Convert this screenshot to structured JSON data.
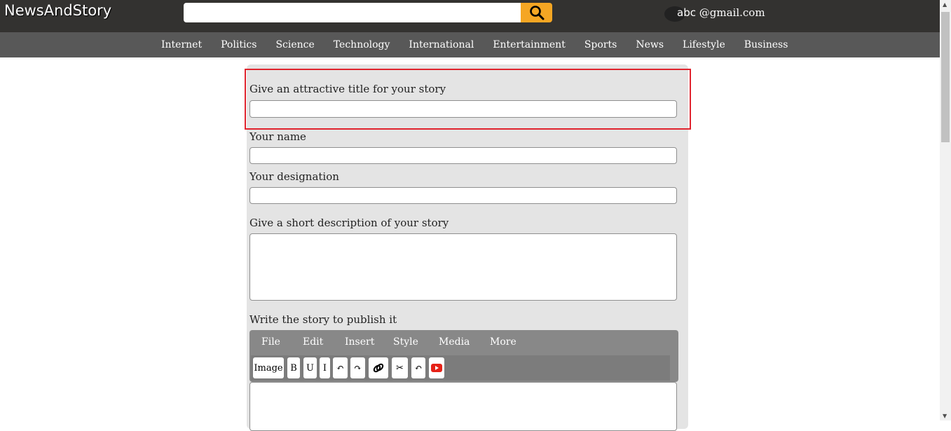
{
  "header": {
    "logo": "NewsAndStory",
    "search_placeholder": "",
    "user_prefix": "abc",
    "user_email": "@gmail.com"
  },
  "nav": [
    "Internet",
    "Politics",
    "Science",
    "Technology",
    "International",
    "Entertainment",
    "Sports",
    "News",
    "Lifestyle",
    "Business"
  ],
  "form": {
    "title_label": "Give an attractive title for your story",
    "name_label": "Your name",
    "designation_label": "Your designation",
    "description_label": "Give a short description of your story",
    "story_label": "Write the story to publish it"
  },
  "editor": {
    "menus": [
      "File",
      "Edit",
      "Insert",
      "Style",
      "Media",
      "More"
    ],
    "tools": {
      "image": "Image",
      "bold": "B",
      "underline": "U",
      "italic": "I",
      "undo": "↶",
      "redo": "↷",
      "link": "link-icon",
      "cut": "✂",
      "undo2": "↶",
      "youtube": "youtube-icon"
    }
  },
  "colors": {
    "topbar": "#333230",
    "navbar": "#585858",
    "search_button": "#f5a623",
    "highlight": "#e0242e",
    "youtube": "#e62117"
  }
}
